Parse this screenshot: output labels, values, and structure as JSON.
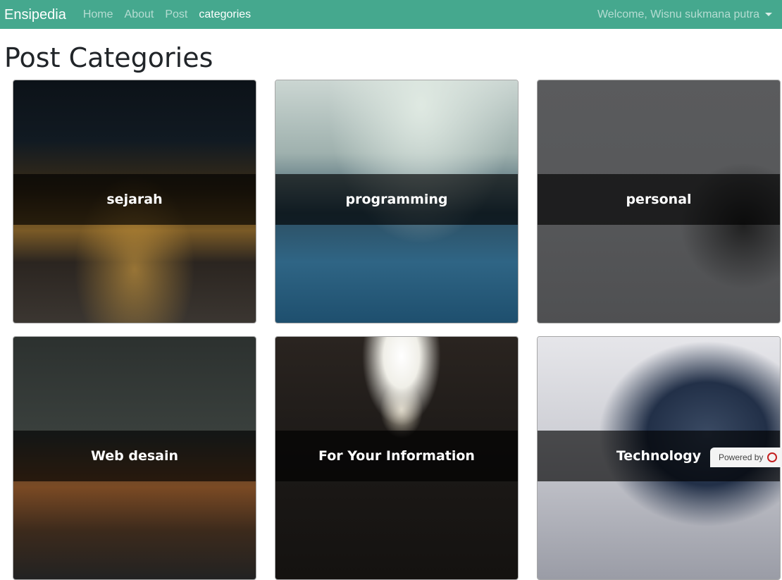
{
  "navbar": {
    "brand": "Ensipedia",
    "links": [
      {
        "label": "Home",
        "active": false
      },
      {
        "label": "About",
        "active": false
      },
      {
        "label": "Post",
        "active": false
      },
      {
        "label": "categories",
        "active": true
      }
    ],
    "user_menu": "Welcome, Wisnu sukmana putra",
    "bg_color": "#45a88e"
  },
  "page": {
    "title": "Post Categories"
  },
  "categories": [
    {
      "name": "sejarah"
    },
    {
      "name": "programming"
    },
    {
      "name": "personal"
    },
    {
      "name": "Web desain"
    },
    {
      "name": "For Your Information"
    },
    {
      "name": "Technology"
    }
  ],
  "badge": {
    "text": "Powered by"
  }
}
